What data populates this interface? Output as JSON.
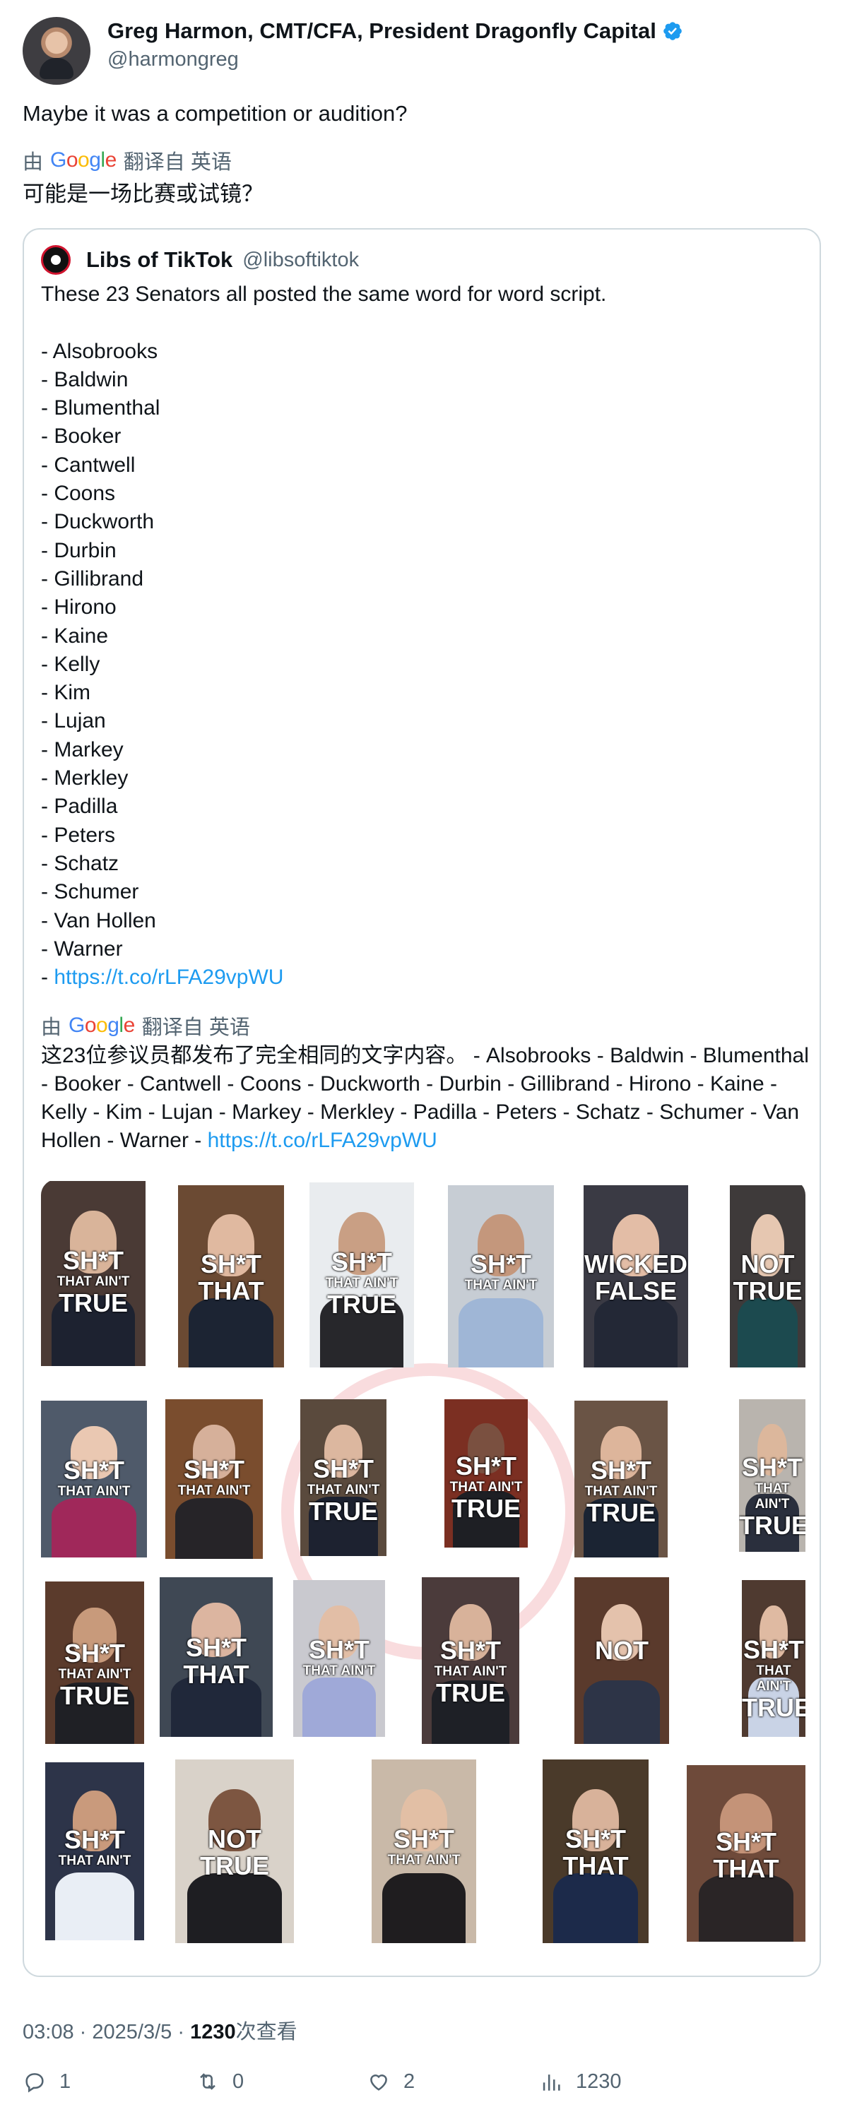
{
  "author": {
    "name": "Greg Harmon, CMT/CFA, President Dragonfly Capital",
    "handle": "@harmongreg",
    "verified_icon": "verified-badge-icon"
  },
  "post": {
    "text": "Maybe it was a competition or audition?",
    "translate_label_prefix": "由",
    "translate_brand": "Google",
    "translate_label_suffix": "翻译自 英语",
    "translated_text": "可能是一场比赛或试镜？"
  },
  "quoted": {
    "name": "Libs of TikTok",
    "handle": "@libsoftiktok",
    "lines": [
      "These 23 Senators all posted the same word for word script.",
      "",
      "- Alsobrooks",
      "- Baldwin",
      "- Blumenthal",
      "- Booker",
      "- Cantwell",
      "- Coons",
      "- Duckworth",
      "- Durbin",
      "- Gillibrand",
      "- Hirono",
      "- Kaine",
      "- Kelly",
      "- Kim",
      "- Lujan",
      "- Markey",
      "- Merkley",
      "- Padilla",
      "- Peters",
      "- Schatz",
      "- Schumer",
      "- Van Hollen",
      "- Warner"
    ],
    "last_line_prefix": "- ",
    "link": "https://t.co/rLFA29vpWU",
    "translate_label_prefix": "由",
    "translate_brand": "Google",
    "translate_label_suffix": "翻译自 英语",
    "translated_text": "这23位参议员都发布了完全相同的文字内容。 - Alsobrooks - Baldwin - Blumenthal - Booker - Cantwell - Coons - Duckworth - Durbin - Gillibrand - Hirono - Kaine - Kelly - Kim - Lujan - Markey - Merkley - Padilla - Peters - Schatz - Schumer - Van Hollen - Warner -",
    "translated_link": "https://t.co/rLFA29vpWU"
  },
  "media": {
    "tiles": [
      {
        "lines": [
          "SH*T",
          "THAT AIN'T",
          "TRUE"
        ],
        "bg": "#4a3a35",
        "face": "#d9b49a",
        "suit": "#1d2230"
      },
      {
        "lines": [
          "SH*T",
          "THAT"
        ],
        "bg": "#6b4a33",
        "face": "#e0b9a0",
        "suit": "#1c2433"
      },
      {
        "lines": [
          "SH*T",
          "THAT AIN'T",
          "TRUE"
        ],
        "bg": "#e9ecef",
        "face": "#c99f84",
        "suit": "#27272b"
      },
      {
        "lines": [
          "SH*T",
          "THAT AIN'T"
        ],
        "bg": "#c7cdd4",
        "face": "#c4977c",
        "suit": "#9fb6d6"
      },
      {
        "lines": [
          "WICKED",
          "FALSE"
        ],
        "bg": "#3a3a44",
        "face": "#e3bda6",
        "suit": "#232836"
      },
      {
        "lines": [
          "NOT",
          "TRUE"
        ],
        "bg": "#3e3a3a",
        "face": "#e6c7b1",
        "suit": "#1c4a4f"
      },
      {
        "lines": [
          "SH*T",
          "THAT AIN'T"
        ],
        "bg": "#4f5a6a",
        "face": "#eac8b2",
        "suit": "#a0285a"
      },
      {
        "lines": [
          "SH*T",
          "THAT AIN'T"
        ],
        "bg": "#7a4d2e",
        "face": "#d6b09a",
        "suit": "#262428"
      },
      {
        "lines": [
          "SH*T",
          "THAT AIN'T",
          "TRUE"
        ],
        "bg": "#5a4a3d",
        "face": "#dcb79f",
        "suit": "#1d2230"
      },
      {
        "lines": [
          "SH*T",
          "THAT AIN'T",
          "TRUE"
        ],
        "bg": "#7b2f22",
        "face": "#7a5040",
        "suit": "#1e1f24"
      },
      {
        "lines": [
          "SH*T",
          "THAT AIN'T",
          "TRUE"
        ],
        "bg": "#6a5445",
        "face": "#ddb59b",
        "suit": "#1b2433"
      },
      {
        "lines": [
          "SH*T",
          "THAT AIN'T",
          "TRUE"
        ],
        "bg": "#b9b4ae",
        "face": "#dcb79c",
        "suit": "#2a2f3d"
      },
      {
        "lines": [
          "SH*T",
          "THAT AIN'T",
          "TRUE"
        ],
        "bg": "#5b3b2c",
        "face": "#c89a7b",
        "suit": "#1f2025"
      },
      {
        "lines": [
          "SH*T",
          "THAT"
        ],
        "bg": "#3f4854",
        "face": "#dcb5a0",
        "suit": "#20283a"
      },
      {
        "lines": [
          "SH*T",
          "THAT AIN'T"
        ],
        "bg": "#c9c9cf",
        "face": "#e2bea6",
        "suit": "#9fa9d8"
      },
      {
        "lines": [
          "SH*T",
          "THAT AIN'T",
          "TRUE"
        ],
        "bg": "#4b3b3b",
        "face": "#d8b29a",
        "suit": "#1e2026"
      },
      {
        "lines": [
          "NOT"
        ],
        "bg": "#5a3a2c",
        "face": "#e4c2ac",
        "suit": "#2d3447"
      },
      {
        "lines": [
          "SH*T",
          "THAT AIN'T",
          "TRUE"
        ],
        "bg": "#4f3a30",
        "face": "#dfbaa2",
        "suit": "#c9d3e6"
      },
      {
        "lines": [
          "SH*T",
          "THAT AIN'T"
        ],
        "bg": "#2d3449",
        "face": "#c99a7c",
        "suit": "#e9eef5"
      },
      {
        "lines": [
          "NOT",
          "TRUE"
        ],
        "bg": "#d9d2c9",
        "face": "#7d5641",
        "suit": "#1e1e22"
      },
      {
        "lines": [
          "SH*T",
          "THAT AIN'T"
        ],
        "bg": "#c9b9a8",
        "face": "#e2bfa5",
        "suit": "#1f1d1f"
      },
      {
        "lines": [
          "SH*T",
          "THAT"
        ],
        "bg": "#4a3a2a",
        "face": "#d8b29a",
        "suit": "#1c2a4a"
      },
      {
        "lines": [
          "SH*T",
          "THAT"
        ],
        "bg": "#6e4a3a",
        "face": "#c49378",
        "suit": "#2a2526"
      }
    ]
  },
  "meta": {
    "time": "03:08",
    "separator": "·",
    "date": "2025/3/5",
    "views_count": "1230",
    "views_label": "次查看"
  },
  "actions": {
    "reply_count": "1",
    "retweet_count": "0",
    "like_count": "2",
    "views_count": "1230"
  },
  "colors": {
    "link": "#1d9bf0",
    "muted": "#536471",
    "border": "#cfd9de",
    "verified": "#1d9bf0"
  }
}
